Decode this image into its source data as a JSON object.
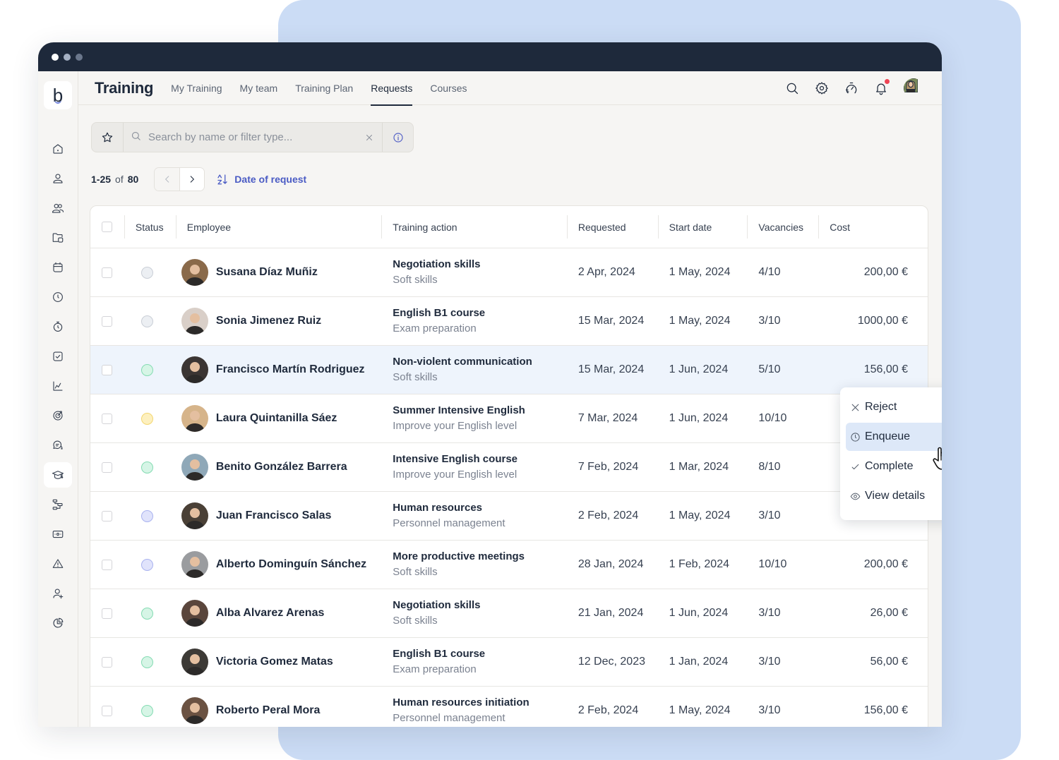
{
  "app": {
    "title": "Training",
    "tabs": [
      {
        "label": "My Training",
        "active": false
      },
      {
        "label": "My team",
        "active": false
      },
      {
        "label": "Training Plan",
        "active": false
      },
      {
        "label": "Requests",
        "active": true
      },
      {
        "label": "Courses",
        "active": false
      }
    ],
    "logo_letter": "b",
    "header_icons": [
      "search-icon",
      "gear-icon",
      "speedometer-icon",
      "bell-icon",
      "user-avatar"
    ],
    "notification_badge_color": "#ef4454"
  },
  "sidebar": {
    "items": [
      {
        "icon": "home-icon"
      },
      {
        "icon": "user-icon"
      },
      {
        "icon": "users-icon"
      },
      {
        "icon": "folder-icon"
      },
      {
        "icon": "calendar-icon"
      },
      {
        "icon": "clock-icon"
      },
      {
        "icon": "stopwatch-icon"
      },
      {
        "icon": "checkbox-icon"
      },
      {
        "icon": "chart-icon"
      },
      {
        "icon": "target-icon"
      },
      {
        "icon": "chat-icon"
      },
      {
        "icon": "graduation-cap-icon",
        "active": true
      },
      {
        "icon": "workflow-icon"
      },
      {
        "icon": "money-icon"
      },
      {
        "icon": "warning-icon"
      },
      {
        "icon": "user-plus-icon"
      },
      {
        "icon": "pie-chart-icon"
      }
    ]
  },
  "search": {
    "placeholder": "Search by name or filter type...",
    "value": ""
  },
  "pagination": {
    "range": "1-25",
    "of_label": "of",
    "total": "80"
  },
  "sort": {
    "label": "Date of request"
  },
  "table": {
    "columns": {
      "status": "Status",
      "employee": "Employee",
      "training_action": "Training action",
      "requested": "Requested",
      "start_date": "Start date",
      "vacancies": "Vacancies",
      "cost": "Cost"
    },
    "status_colors": {
      "pending": {
        "fill": "#eceff3",
        "border": "#c9ced6"
      },
      "approved": {
        "fill": "#d6f5e6",
        "border": "#84dbb2"
      },
      "warning": {
        "fill": "#fdf0bf",
        "border": "#f3d670"
      },
      "queued": {
        "fill": "#e0e3fb",
        "border": "#a9b2ef"
      }
    },
    "rows": [
      {
        "status": "pending",
        "employee": "Susana Díaz Muñiz",
        "training": "Negotiation skills",
        "category": "Soft skills",
        "requested": "2 Apr, 2024",
        "start": "1 May, 2024",
        "vacancies": "4/10",
        "cost": "200,00 €",
        "avatar_color": "#8a6a4a"
      },
      {
        "status": "pending",
        "employee": "Sonia Jimenez Ruiz",
        "training": "English B1 course",
        "category": "Exam preparation",
        "requested": "15 Mar, 2024",
        "start": "1 May, 2024",
        "vacancies": "3/10",
        "cost": "1000,00 €",
        "avatar_color": "#d9cfc8"
      },
      {
        "status": "approved",
        "employee": "Francisco Martín Rodriguez",
        "training": "Non-violent communication",
        "category": "Soft skills",
        "requested": "15 Mar, 2024",
        "start": "1 Jun, 2024",
        "vacancies": "5/10",
        "cost": "156,00 €",
        "avatar_color": "#3b3533",
        "highlighted": true
      },
      {
        "status": "warning",
        "employee": "Laura Quintanilla Sáez",
        "training": "Summer Intensive English",
        "category": "Improve your English level",
        "requested": "7 Mar, 2024",
        "start": "1 Jun, 2024",
        "vacancies": "10/10",
        "cost": "",
        "avatar_color": "#d6b48a"
      },
      {
        "status": "approved",
        "employee": "Benito González Barrera",
        "training": "Intensive English course",
        "category": "Improve your English level",
        "requested": "7 Feb, 2024",
        "start": "1 Mar, 2024",
        "vacancies": "8/10",
        "cost": "",
        "avatar_color": "#8fa8b8"
      },
      {
        "status": "queued",
        "employee": "Juan Francisco Salas",
        "training": "Human resources",
        "category": "Personnel management",
        "requested": "2 Feb, 2024",
        "start": "1 May, 2024",
        "vacancies": "3/10",
        "cost": "",
        "avatar_color": "#4a4036"
      },
      {
        "status": "queued",
        "employee": "Alberto Dominguín Sánchez",
        "training": "More productive meetings",
        "category": "Soft skills",
        "requested": "28 Jan, 2024",
        "start": "1 Feb, 2024",
        "vacancies": "10/10",
        "cost": "200,00 €",
        "avatar_color": "#9a9c9f"
      },
      {
        "status": "approved",
        "employee": "Alba Alvarez Arenas",
        "training": "Negotiation skills",
        "category": "Soft skills",
        "requested": "21 Jan, 2024",
        "start": "1 Jun, 2024",
        "vacancies": "3/10",
        "cost": "26,00 €",
        "avatar_color": "#5a463c"
      },
      {
        "status": "approved",
        "employee": "Victoria Gomez Matas",
        "training": "English B1 course",
        "category": "Exam preparation",
        "requested": "12 Dec, 2023",
        "start": "1 Jan, 2024",
        "vacancies": "3/10",
        "cost": "56,00 €",
        "avatar_color": "#3d3a36"
      },
      {
        "status": "approved",
        "employee": "Roberto Peral Mora",
        "training": "Human resources initiation",
        "category": "Personnel management",
        "requested": "2 Feb, 2024",
        "start": "1 May, 2024",
        "vacancies": "3/10",
        "cost": "156,00 €",
        "avatar_color": "#6b5242"
      }
    ]
  },
  "context_menu": {
    "items": [
      {
        "label": "Reject",
        "icon": "x-icon"
      },
      {
        "label": "Enqueue",
        "icon": "clock-icon",
        "hover": true
      },
      {
        "label": "Complete",
        "icon": "check-icon"
      },
      {
        "label": "View details",
        "icon": "eye-icon"
      }
    ]
  }
}
